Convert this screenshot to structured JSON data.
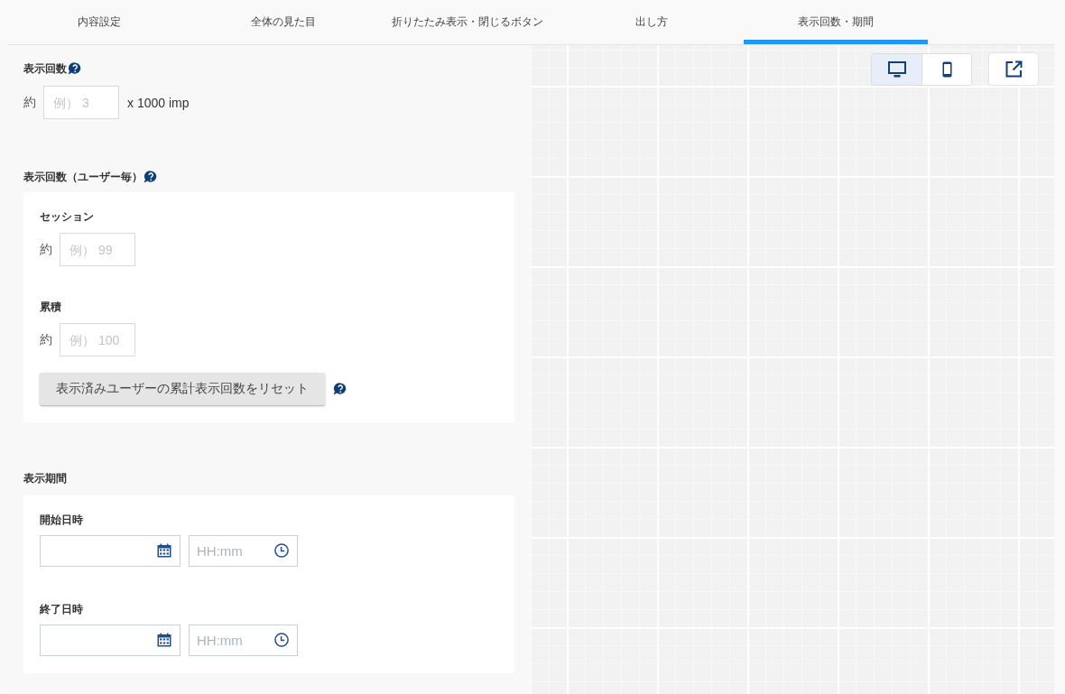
{
  "tabs": [
    {
      "label": "内容設定",
      "selected": false
    },
    {
      "label": "全体の見た目",
      "selected": false
    },
    {
      "label": "折りたたみ表示・閉じるボタン",
      "selected": false
    },
    {
      "label": "出し方",
      "selected": false
    },
    {
      "label": "表示回数・期間",
      "selected": true
    }
  ],
  "display_count": {
    "label": "表示回数",
    "help": true,
    "prefix": "約",
    "placeholder": "例） 3",
    "unit": "x 1000 imp"
  },
  "per_user": {
    "label": "表示回数（ユーザー毎）",
    "help": true,
    "fields": [
      {
        "label": "セッション",
        "prefix": "約",
        "placeholder": "例） 99"
      },
      {
        "label": "累積",
        "prefix": "約",
        "placeholder": "例） 100"
      }
    ],
    "reset_button": {
      "label": "表示済みユーザーの累計表示回数をリセット",
      "help": true
    }
  },
  "period": {
    "label": "表示期間",
    "help": false,
    "fields": [
      {
        "label": "開始日時",
        "time_placeholder": "HH:mm"
      },
      {
        "label": "終了日時",
        "time_placeholder": "HH:mm"
      }
    ]
  },
  "preview": {
    "devices": [
      {
        "kind": "desktop",
        "selected": true
      },
      {
        "kind": "mobile",
        "selected": false
      }
    ]
  }
}
